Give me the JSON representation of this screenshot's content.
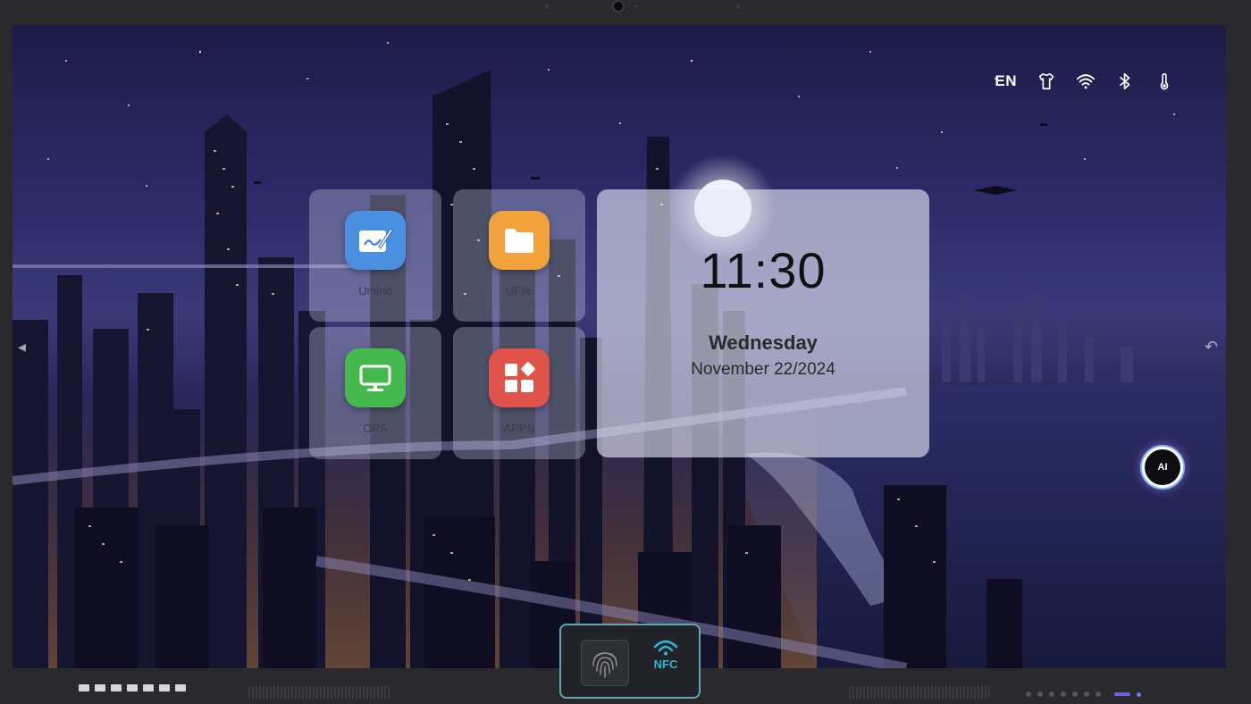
{
  "status_bar": {
    "language": "EN",
    "icons": [
      "shirt-icon",
      "wifi-icon",
      "bluetooth-icon",
      "thermometer-icon"
    ]
  },
  "apps": [
    {
      "label": "Umind",
      "icon": "whiteboard-pen-icon",
      "color": "#4a8fe0"
    },
    {
      "label": "UFile",
      "icon": "folder-icon",
      "color": "#f2a23a"
    },
    {
      "label": "OPS",
      "icon": "monitor-icon",
      "color": "#45b84e"
    },
    {
      "label": "APPS",
      "icon": "app-grid-icon",
      "color": "#e0534a"
    }
  ],
  "clock": {
    "time": "11:30",
    "day": "Wednesday",
    "date": "November 22/2024"
  },
  "ai_button": {
    "label": "AI"
  },
  "nfc_module": {
    "nfc_label": "NFC"
  }
}
